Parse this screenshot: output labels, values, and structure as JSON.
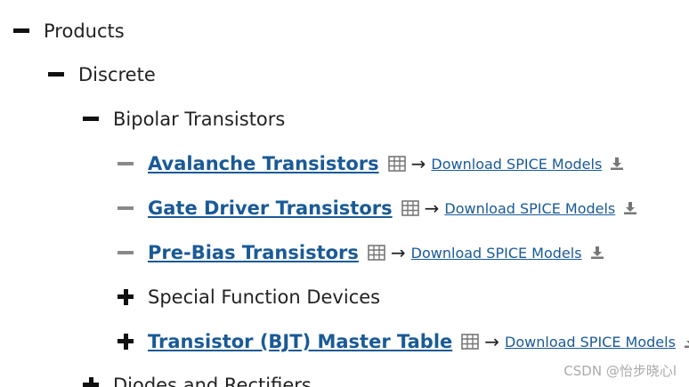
{
  "tree": {
    "products": {
      "label": "Products",
      "state": "expanded"
    },
    "discrete": {
      "label": "Discrete",
      "state": "expanded"
    },
    "bipolar": {
      "label": "Bipolar Transistors",
      "state": "expanded"
    },
    "items": [
      {
        "label": "Avalanche Transistors",
        "download": "Download SPICE Models"
      },
      {
        "label": "Gate Driver Transistors",
        "download": "Download SPICE Models"
      },
      {
        "label": "Pre-Bias Transistors",
        "download": "Download SPICE Models"
      }
    ],
    "special": {
      "label": "Special Function Devices",
      "state": "collapsed"
    },
    "master": {
      "label": "Transistor (BJT) Master Table",
      "download": "Download SPICE Models",
      "state": "collapsed"
    },
    "diodes": {
      "label": "Diodes and Rectifiers",
      "state": "collapsed"
    }
  },
  "arrow_glyph": "→",
  "watermark": "CSDN @怡步晓心l",
  "colors": {
    "link": "#1a5a96",
    "text": "#222222",
    "leaf_toggle": "#8a8a8a"
  }
}
